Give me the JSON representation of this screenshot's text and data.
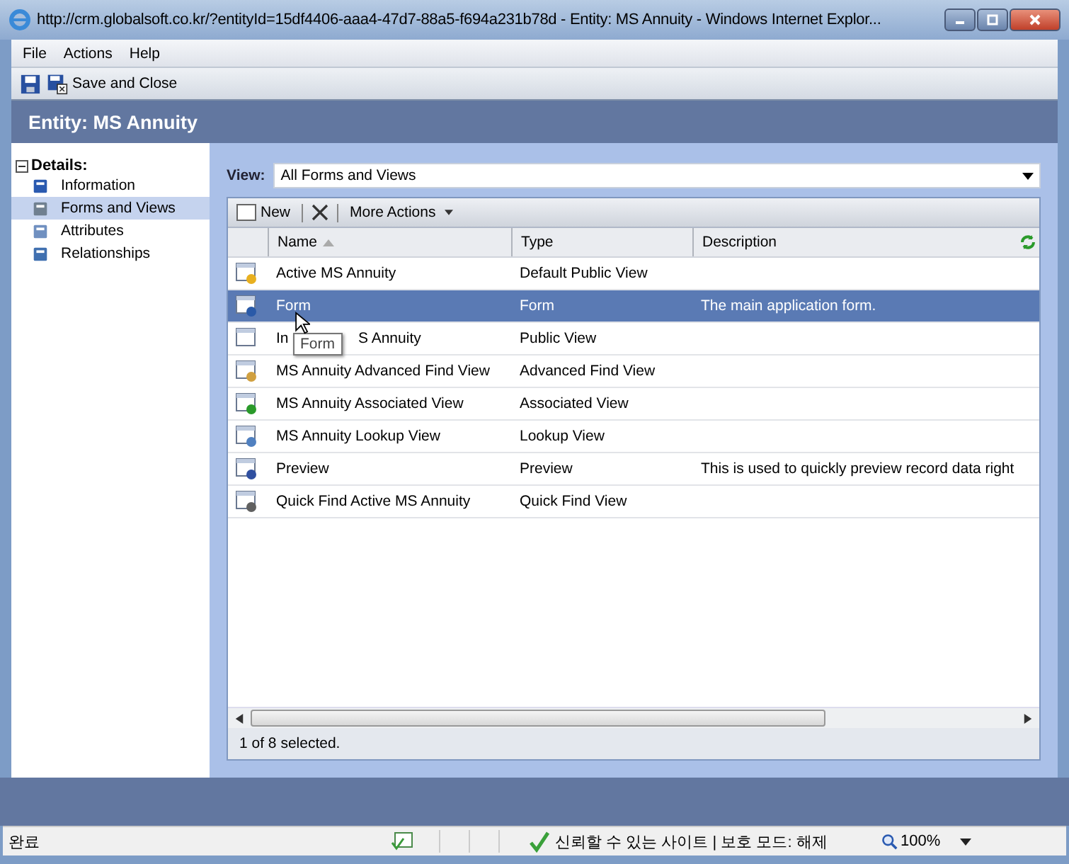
{
  "window": {
    "title": "http://crm.globalsoft.co.kr/?entityId=15df4406-aaa4-47d7-88a5-f694a231b78d - Entity: MS Annuity - Windows Internet Explor..."
  },
  "menu": [
    {
      "label": "File"
    },
    {
      "label": "Actions"
    },
    {
      "label": "Help"
    }
  ],
  "toolbar": {
    "save_close": "Save and Close"
  },
  "header": "Entity: MS Annuity",
  "sidebar": {
    "section": "Details:",
    "expanded": true,
    "items": [
      {
        "label": "Information",
        "kind": "info",
        "selected": false
      },
      {
        "label": "Forms and Views",
        "kind": "forms",
        "selected": true
      },
      {
        "label": "Attributes",
        "kind": "attributes",
        "selected": false
      },
      {
        "label": "Relationships",
        "kind": "relationships",
        "selected": false
      }
    ]
  },
  "view": {
    "label": "View:",
    "value": "All Forms and Views"
  },
  "grid_toolbar": {
    "new": "New",
    "more": "More Actions"
  },
  "table": {
    "columns": [
      "Name",
      "Type",
      "Description"
    ],
    "rows": [
      {
        "name": "Active MS Annuity",
        "type": "Default Public View",
        "description": "",
        "kind": "star",
        "selected": false
      },
      {
        "name": "Form",
        "type": "Form",
        "description": "The main application form.",
        "kind": "form",
        "selected": true
      },
      {
        "name": "In",
        "name_tail": "S Annuity",
        "type": "Public View",
        "description": "",
        "kind": "blank",
        "selected": false
      },
      {
        "name": "MS Annuity Advanced Find View",
        "type": "Advanced Find View",
        "description": "",
        "kind": "find",
        "selected": false
      },
      {
        "name": "MS Annuity Associated View",
        "type": "Associated View",
        "description": "",
        "kind": "add",
        "selected": false
      },
      {
        "name": "MS Annuity Lookup View",
        "type": "Lookup View",
        "description": "",
        "kind": "lookup",
        "selected": false
      },
      {
        "name": "Preview",
        "type": "Preview",
        "description": "This is used to quickly preview record data right",
        "kind": "preview",
        "selected": false
      },
      {
        "name": "Quick Find Active MS Annuity",
        "type": "Quick Find View",
        "description": "",
        "kind": "quickfind",
        "selected": false
      }
    ]
  },
  "tooltip": "Form",
  "grid_status": "1 of 8 selected.",
  "status_bar": {
    "text": "완료",
    "zone": "신뢰할 수 있는 사이트 | 보호 모드: 해제",
    "zoom": "100%"
  }
}
